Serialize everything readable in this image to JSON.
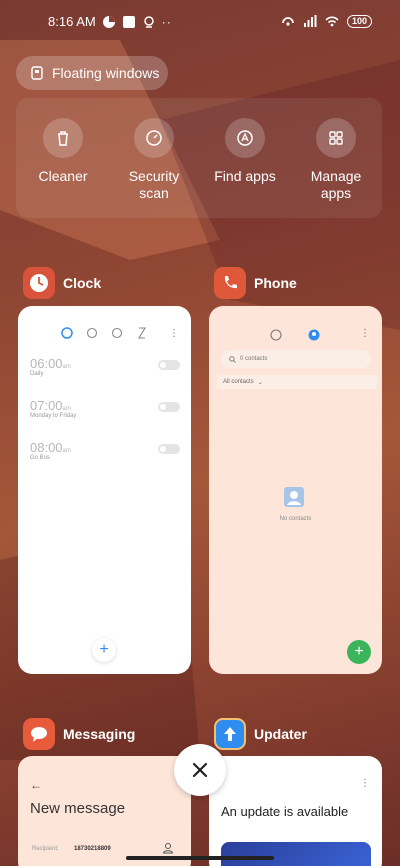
{
  "status_bar": {
    "time": "8:16 AM",
    "battery": "100",
    "icons": [
      "notification-icon",
      "square-icon",
      "location-icon",
      "more-icon",
      "hotspot-icon",
      "signal-icon",
      "wifi-icon",
      "battery-icon"
    ]
  },
  "floating_windows": {
    "label": "Floating windows",
    "icon": "floating-window-icon"
  },
  "quick_actions": [
    {
      "label_line1": "Cleaner",
      "label_line2": "",
      "icon": "trash-icon"
    },
    {
      "label_line1": "Security",
      "label_line2": "scan",
      "icon": "gauge-icon"
    },
    {
      "label_line1": "Find apps",
      "label_line2": "",
      "icon": "search-apps-icon"
    },
    {
      "label_line1": "Manage",
      "label_line2": "apps",
      "icon": "grid-icon"
    }
  ],
  "apps": {
    "clock": {
      "name": "Clock",
      "color": "#d9533a",
      "alarms": [
        {
          "time": "06:00",
          "ampm": "am",
          "sub": "Daily"
        },
        {
          "time": "07:00",
          "ampm": "am",
          "sub": "Monday to Friday"
        },
        {
          "time": "08:00",
          "ampm": "am",
          "sub": "Go Bus"
        }
      ]
    },
    "phone": {
      "name": "Phone",
      "color": "#e0583a",
      "search_placeholder": "0 contacts",
      "filter": "All contacts",
      "empty": "No contacts"
    },
    "messaging": {
      "name": "Messaging",
      "color": "#e85a3c",
      "title": "New message",
      "recipient_label": "Recipient:",
      "recipient_value": "18730218809"
    },
    "updater": {
      "name": "Updater",
      "color": "#2f8df0",
      "title": "An update is available"
    }
  },
  "colors": {
    "accent_blue": "#2f8df0",
    "add_green": "#3cb45c"
  }
}
